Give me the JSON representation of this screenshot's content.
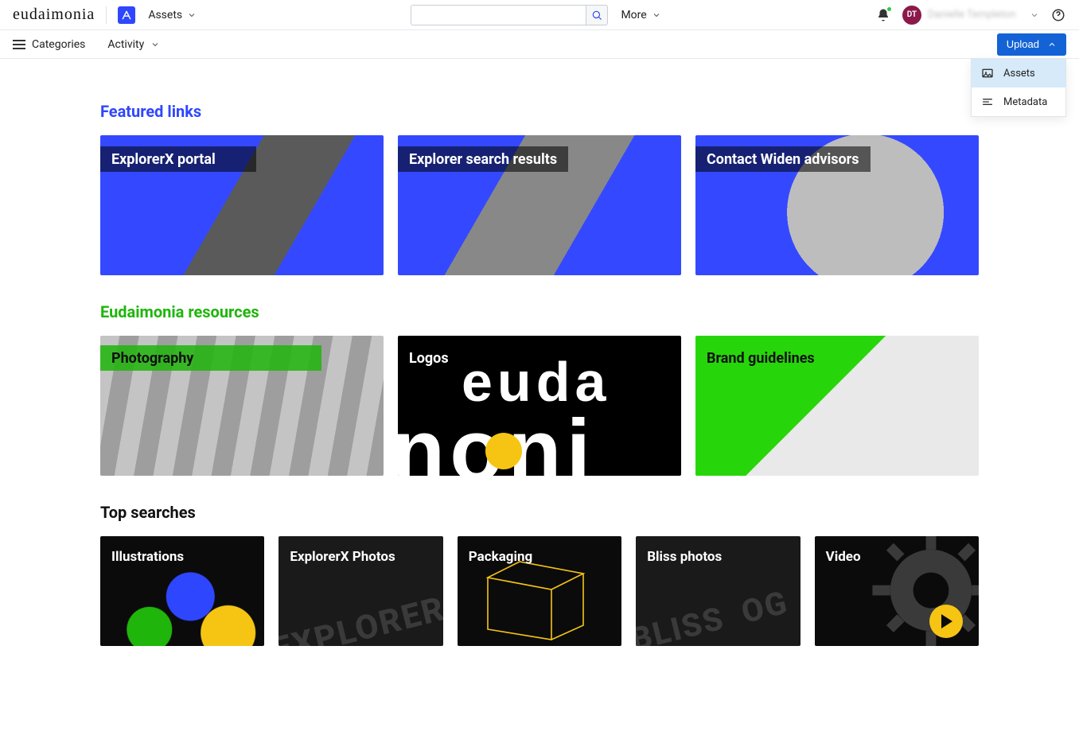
{
  "header": {
    "brand": "eudaimonia",
    "assets_dropdown_label": "Assets",
    "more_label": "More",
    "search_placeholder": "",
    "user_initials": "DT",
    "user_name": "Danielle Templeton"
  },
  "secbar": {
    "categories_label": "Categories",
    "activity_label": "Activity",
    "upload_label": "Upload",
    "upload_menu": [
      {
        "label": "Assets",
        "icon": "image-icon",
        "active": true
      },
      {
        "label": "Metadata",
        "icon": "lines-icon",
        "active": false
      }
    ]
  },
  "sections": {
    "featured": {
      "title": "Featured links",
      "cards": [
        {
          "label": "ExplorerX portal"
        },
        {
          "label": "Explorer search results"
        },
        {
          "label": "Contact Widen advisors"
        }
      ]
    },
    "resources": {
      "title": "Eudaimonia resources",
      "cards": [
        {
          "label": "Photography"
        },
        {
          "label": "Logos"
        },
        {
          "label": "Brand guidelines"
        }
      ]
    },
    "top_searches": {
      "title": "Top searches",
      "cards": [
        {
          "label": "Illustrations"
        },
        {
          "label": "ExplorerX Photos"
        },
        {
          "label": "Packaging"
        },
        {
          "label": "Bliss photos"
        },
        {
          "label": "Video"
        }
      ]
    }
  }
}
